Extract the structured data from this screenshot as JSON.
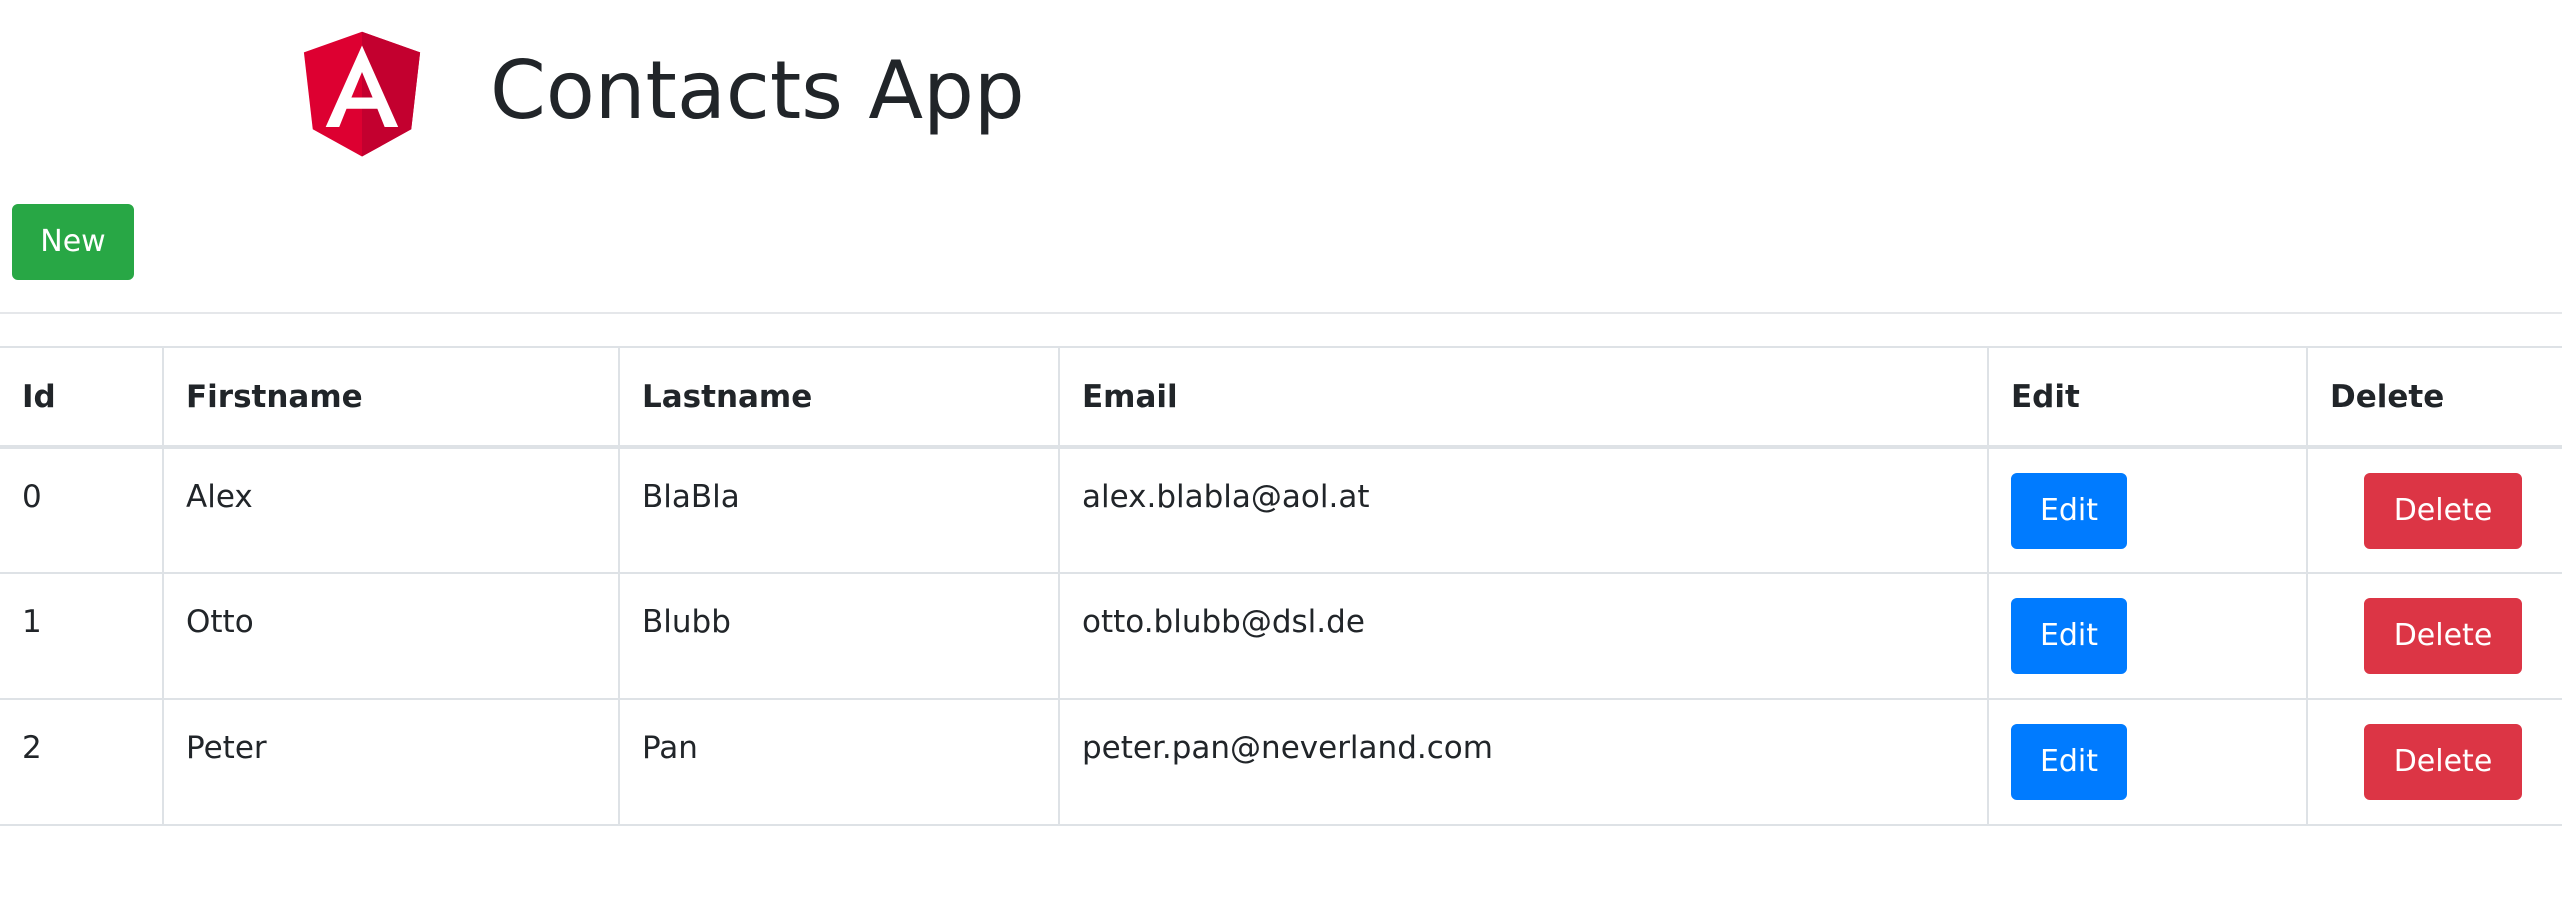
{
  "header": {
    "title": "Contacts App",
    "logo_letter": "A",
    "logo_colors": {
      "left": "#dd0031",
      "right": "#c3002f",
      "letter": "#ffffff"
    }
  },
  "toolbar": {
    "new_label": "New"
  },
  "table": {
    "columns": [
      "Id",
      "Firstname",
      "Lastname",
      "Email",
      "Edit",
      "Delete"
    ],
    "rows": [
      {
        "id": "0",
        "firstname": "Alex",
        "lastname": "BlaBla",
        "email": "alex.blabla@aol.at"
      },
      {
        "id": "1",
        "firstname": "Otto",
        "lastname": "Blubb",
        "email": "otto.blubb@dsl.de"
      },
      {
        "id": "2",
        "firstname": "Peter",
        "lastname": "Pan",
        "email": "peter.pan@neverland.com"
      }
    ],
    "edit_label": "Edit",
    "delete_label": "Delete"
  },
  "colors": {
    "success": "#28a745",
    "primary": "#007bff",
    "danger": "#dc3545",
    "text": "#212529",
    "border": "#dee2e6"
  }
}
